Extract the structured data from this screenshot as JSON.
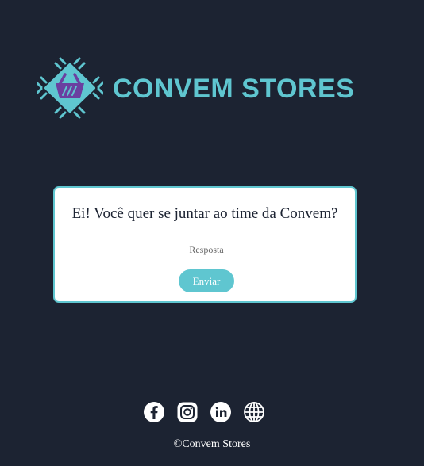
{
  "brand": {
    "name": "CONVEM STORES",
    "color": "#5fc6d0",
    "icon": "shopping-basket-chip-icon"
  },
  "form": {
    "question": "Ei! Você quer se juntar ao time da Convem?",
    "answer_placeholder": "Resposta",
    "answer_value": "",
    "submit_label": "Enviar"
  },
  "social": [
    {
      "icon": "facebook-icon"
    },
    {
      "icon": "instagram-icon"
    },
    {
      "icon": "linkedin-icon"
    },
    {
      "icon": "globe-icon"
    }
  ],
  "footer": {
    "copyright": "©Convem Stores"
  },
  "colors": {
    "background": "#1c2332",
    "accent": "#5fc6d0",
    "basket": "#6b3fa0",
    "card": "#ffffff"
  }
}
